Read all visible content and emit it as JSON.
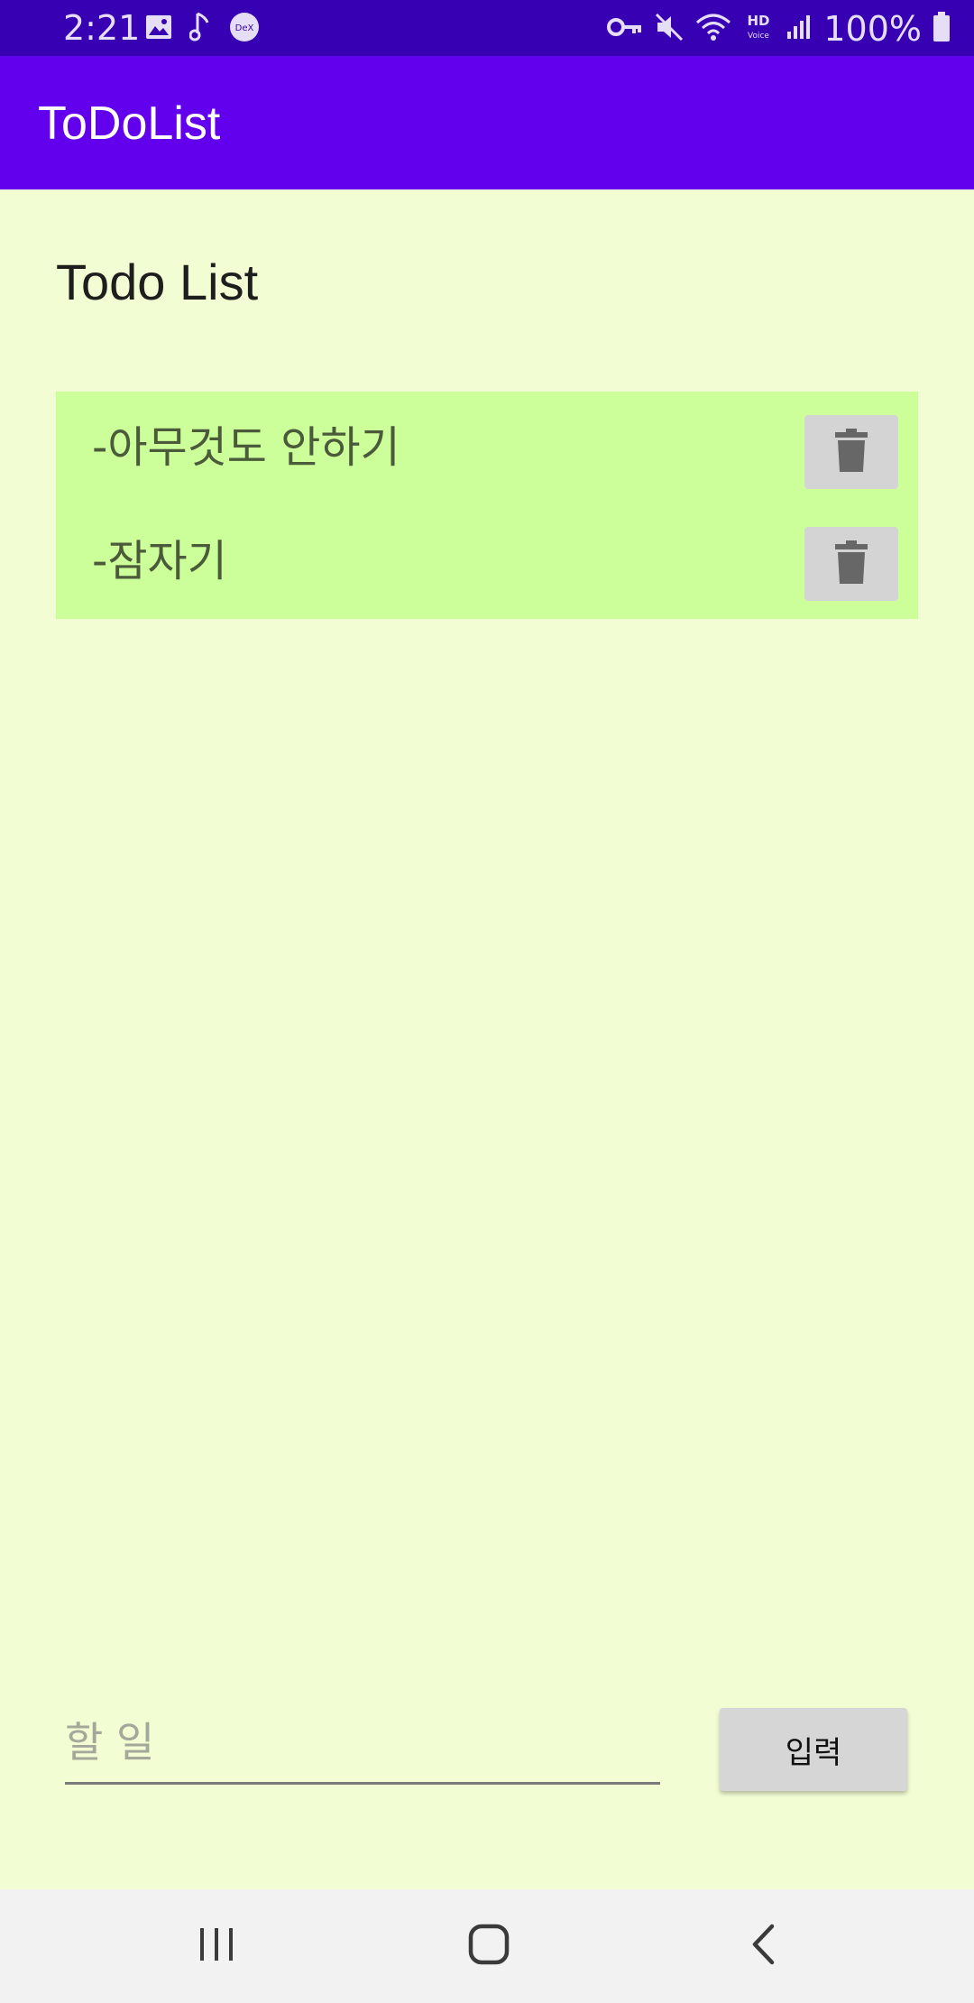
{
  "status_bar": {
    "time": "2:21",
    "battery": "100%",
    "icons_left": [
      "image-icon",
      "music-note-icon",
      "dex-icon"
    ],
    "icons_right": [
      "vpn-key-icon",
      "mute-icon",
      "wifi-icon",
      "hd-voice-icon",
      "signal-icon",
      "battery-icon"
    ],
    "dex_label": "DeX",
    "hd_label": "HD",
    "voice_label": "Voice"
  },
  "app_bar": {
    "title": "ToDoList"
  },
  "main": {
    "heading": "Todo List",
    "todos": [
      {
        "text": "-아무것도 안하기",
        "delete_icon": "trash-icon"
      },
      {
        "text": "-잠자기",
        "delete_icon": "trash-icon"
      }
    ]
  },
  "input": {
    "placeholder": "할 일",
    "value": ""
  },
  "submit_button": {
    "label": "입력"
  },
  "nav_bar": {
    "buttons": [
      "recent-apps-icon",
      "home-icon",
      "back-icon"
    ]
  },
  "colors": {
    "status_bar": "#3700B3",
    "app_bar": "#6200EE",
    "background": "#F2FDD3",
    "list_background": "#CCFF99",
    "delete_button": "#D4D4D4"
  }
}
